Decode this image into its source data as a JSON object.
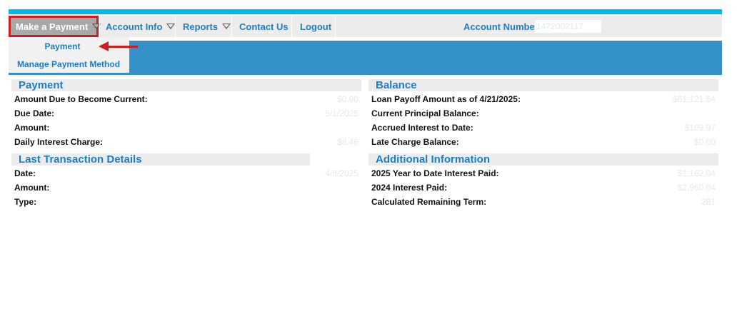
{
  "nav": {
    "make_payment": "Make a Payment",
    "account_info": "Account Info",
    "reports": "Reports",
    "contact_us": "Contact Us",
    "logout": "Logout",
    "account_number_label": "Account Number:",
    "account_number_value": "1472002117"
  },
  "dropdown": {
    "items": [
      {
        "label": "Payment"
      },
      {
        "label": "Manage Payment Method"
      }
    ]
  },
  "payment": {
    "title": "Payment",
    "rows": [
      {
        "label": "Amount Due to Become Current:",
        "value": "$0.00"
      },
      {
        "label": "Due Date:",
        "value": "5/1/2025"
      },
      {
        "label": "Amount:",
        "value": ""
      },
      {
        "label": "Daily Interest Charge:",
        "value": "$8.46"
      }
    ]
  },
  "last_transaction": {
    "title": "Last Transaction Details",
    "rows": [
      {
        "label": "Date:",
        "value": "4/8/2025"
      },
      {
        "label": "Amount:",
        "value": ""
      },
      {
        "label": "Type:",
        "value": ""
      }
    ]
  },
  "balance": {
    "title": "Balance",
    "rows": [
      {
        "label": "Loan Payoff Amount as of 4/21/2025:",
        "value": "$61,121.64"
      },
      {
        "label": "Current Principal Balance:",
        "value": ""
      },
      {
        "label": "Accrued Interest to Date:",
        "value": "$109.97"
      },
      {
        "label": "Late Charge Balance:",
        "value": "$0.00"
      }
    ]
  },
  "additional": {
    "title": "Additional Information",
    "rows": [
      {
        "label": "2025 Year to Date Interest Paid:",
        "value": "$1,162.04"
      },
      {
        "label": "2024 Interest Paid:",
        "value": "$2,960.04"
      },
      {
        "label": "Calculated Remaining Term:",
        "value": "281"
      }
    ]
  },
  "colors": {
    "accent": "#1a7fc4",
    "topbar": "#00b8f0",
    "banner": "#3492c8",
    "highlight": "#d01c1c"
  }
}
